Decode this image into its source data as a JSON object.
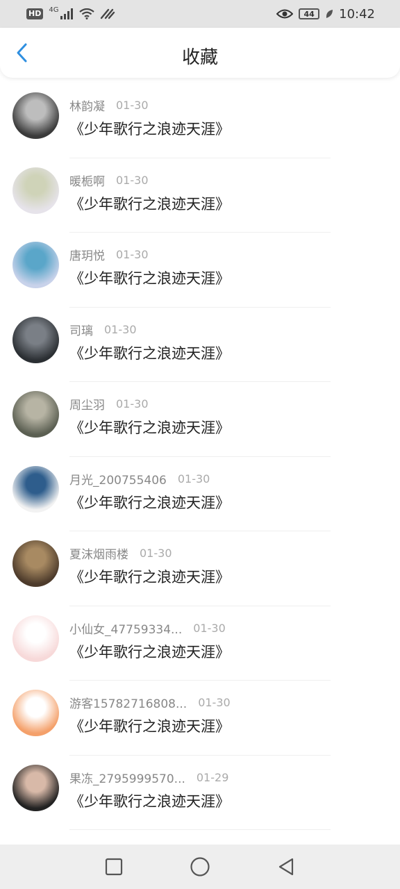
{
  "status_bar": {
    "hd_label": "HD",
    "network_label": "4G",
    "battery_level": "44",
    "time": "10:42"
  },
  "header": {
    "title": "收藏"
  },
  "favorites": [
    {
      "name": "林韵凝",
      "date": "01-30",
      "title": "《少年歌行之浪迹天涯》",
      "avatar_colors": [
        "#3a3a3a",
        "#bdbdbd"
      ]
    },
    {
      "name": "暖栀啊",
      "date": "01-30",
      "title": "《少年歌行之浪迹天涯》",
      "avatar_colors": [
        "#e6e3ea",
        "#cfd3b8"
      ]
    },
    {
      "name": "唐玥悦",
      "date": "01-30",
      "title": "《少年歌行之浪迹天涯》",
      "avatar_colors": [
        "#c8d2ea",
        "#5aa6c9"
      ]
    },
    {
      "name": "司璃",
      "date": "01-30",
      "title": "《少年歌行之浪迹天涯》",
      "avatar_colors": [
        "#2b2f33",
        "#7a7f86"
      ]
    },
    {
      "name": "周尘羽",
      "date": "01-30",
      "title": "《少年歌行之浪迹天涯》",
      "avatar_colors": [
        "#5b5f52",
        "#b7b4a4"
      ]
    },
    {
      "name": "月光_200755406",
      "date": "01-30",
      "title": "《少年歌行之浪迹天涯》",
      "avatar_colors": [
        "#f2f2f2",
        "#2e5d8c"
      ]
    },
    {
      "name": "夏沫烟雨楼",
      "date": "01-30",
      "title": "《少年歌行之浪迹天涯》",
      "avatar_colors": [
        "#4d3b2b",
        "#a88a62"
      ]
    },
    {
      "name": "小仙女_47759334...",
      "date": "01-30",
      "title": "《少年歌行之浪迹天涯》",
      "avatar_colors": [
        "#f7d9d9",
        "#ffffff"
      ]
    },
    {
      "name": "游客15782716808...",
      "date": "01-30",
      "title": "《少年歌行之浪迹天涯》",
      "avatar_colors": [
        "#f4a06a",
        "#ffffff"
      ]
    },
    {
      "name": "果冻_2795999570...",
      "date": "01-29",
      "title": "《少年歌行之浪迹天涯》",
      "avatar_colors": [
        "#222222",
        "#d8b9a8"
      ]
    }
  ],
  "icons": {
    "back": "chevron-left-icon",
    "nav_recent": "square-icon",
    "nav_home": "circle-icon",
    "nav_back": "triangle-back-icon"
  },
  "accent_color": "#2f8fe0"
}
